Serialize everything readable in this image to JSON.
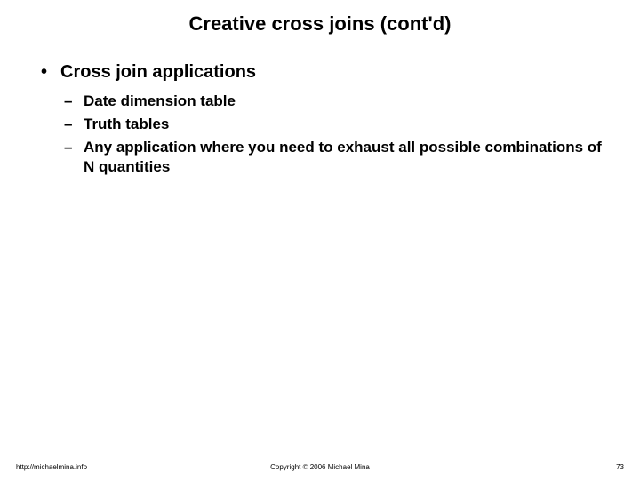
{
  "title": "Creative cross joins (cont'd)",
  "bullets": {
    "main": "Cross join applications",
    "subs": [
      "Date dimension table",
      "Truth tables",
      "Any application where you need to exhaust all possible combinations of N quantities"
    ]
  },
  "footer": {
    "left": "http://michaelmina.info",
    "center": "Copyright © 2006 Michael Mina",
    "right": "73"
  }
}
